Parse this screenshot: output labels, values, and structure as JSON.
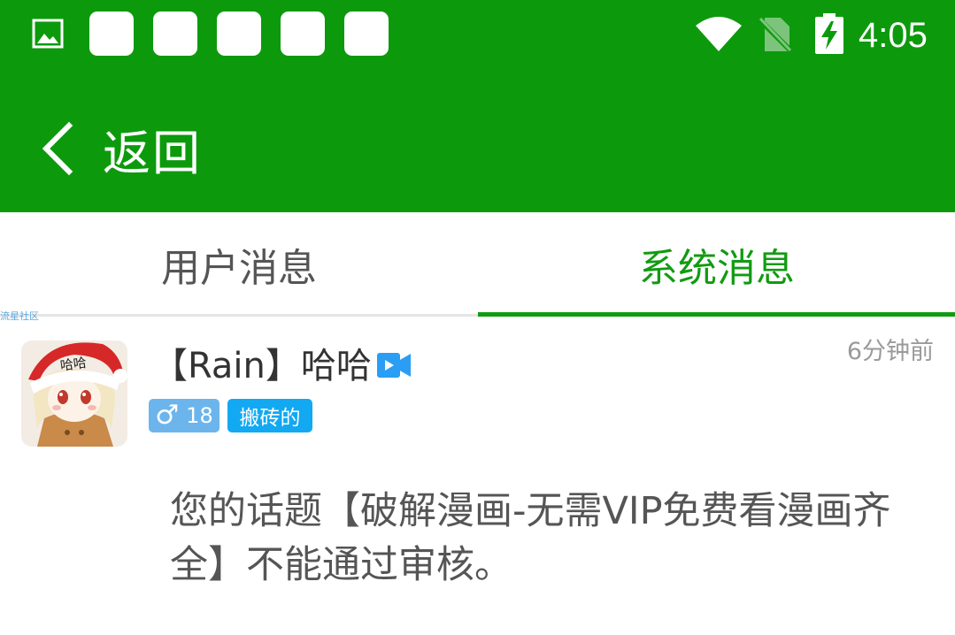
{
  "status_bar": {
    "time": "4:05",
    "icons": [
      "photo-icon",
      "notification-placeholder",
      "wifi-icon",
      "no-sim-icon",
      "battery-charging-icon"
    ]
  },
  "toolbar": {
    "back_label": "返回",
    "back_icon": "chevron-left-icon"
  },
  "tabs": [
    {
      "label": "用户消息",
      "active": false
    },
    {
      "label": "系统消息",
      "active": true
    }
  ],
  "watermark": "流星社区",
  "message": {
    "avatar_text": "哈哈",
    "username": "【Rain】哈哈",
    "time_ago": "6分钟前",
    "gender_symbol": "♂",
    "age": "18",
    "role": "搬砖的",
    "text": "您的话题【破解漫画-无需VIP免费看漫画齐全】不能通过审核。"
  },
  "colors": {
    "primary": "#0c9a0c",
    "tab_active": "#119b11",
    "gender_badge": "#6cb5ec",
    "role_badge": "#12a9f2",
    "video_badge": "#2a9df4"
  }
}
